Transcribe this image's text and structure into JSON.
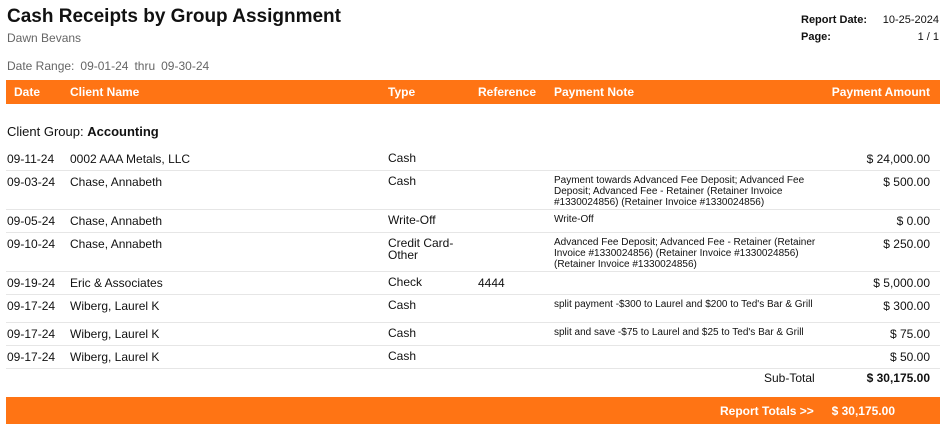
{
  "report": {
    "title": "Cash Receipts by Group Assignment",
    "user": "Dawn Bevans",
    "report_date_label": "Report Date:",
    "report_date": "10-25-2024",
    "page_label": "Page:",
    "page": "1 / 1",
    "date_range_label": "Date Range:",
    "date_from": "09-01-24",
    "thru_label": "thru",
    "date_to": "09-30-24"
  },
  "columns": {
    "date": "Date",
    "client": "Client Name",
    "type": "Type",
    "reference": "Reference",
    "note": "Payment Note",
    "amount": "Payment Amount"
  },
  "group": {
    "label": "Client Group:",
    "name": "Accounting"
  },
  "rows": [
    {
      "date": "09-11-24",
      "client": "0002 AAA Metals, LLC",
      "type": "Cash",
      "reference": "",
      "note": "",
      "amount": "$ 24,000.00"
    },
    {
      "date": "09-03-24",
      "client": "Chase, Annabeth",
      "type": "Cash",
      "reference": "",
      "note": "Payment towards Advanced Fee Deposit; Advanced Fee Deposit; Advanced Fee - Retainer (Retainer Invoice #1330024856) (Retainer Invoice #1330024856)",
      "amount": "$ 500.00"
    },
    {
      "date": "09-05-24",
      "client": "Chase, Annabeth",
      "type": "Write-Off",
      "reference": "",
      "note": "Write-Off",
      "amount": "$ 0.00"
    },
    {
      "date": "09-10-24",
      "client": "Chase, Annabeth",
      "type": "Credit Card-Other",
      "reference": "",
      "note": "Advanced Fee Deposit; Advanced Fee - Retainer (Retainer Invoice #1330024856) (Retainer Invoice #1330024856) (Retainer Invoice #1330024856)",
      "amount": "$ 250.00"
    },
    {
      "date": "09-19-24",
      "client": "Eric & Associates",
      "type": "Check",
      "reference": "4444",
      "note": "",
      "amount": "$ 5,000.00"
    },
    {
      "date": "09-17-24",
      "client": "Wiberg, Laurel K",
      "type": "Cash",
      "reference": "",
      "note": "split payment -$300 to Laurel and $200 to Ted's Bar & Grill",
      "amount": "$ 300.00"
    },
    {
      "date": "09-17-24",
      "client": "Wiberg, Laurel K",
      "type": "Cash",
      "reference": "",
      "note": "split and save -$75 to Laurel and $25 to Ted's Bar & Grill",
      "amount": "$ 75.00"
    },
    {
      "date": "09-17-24",
      "client": "Wiberg, Laurel K",
      "type": "Cash",
      "reference": "",
      "note": "",
      "amount": "$ 50.00"
    }
  ],
  "subtotal": {
    "label": "Sub-Total",
    "value": "$ 30,175.00"
  },
  "totals": {
    "label": "Report Totals >>",
    "value": "$ 30,175.00"
  },
  "colors": {
    "accent": "#ff7414"
  }
}
